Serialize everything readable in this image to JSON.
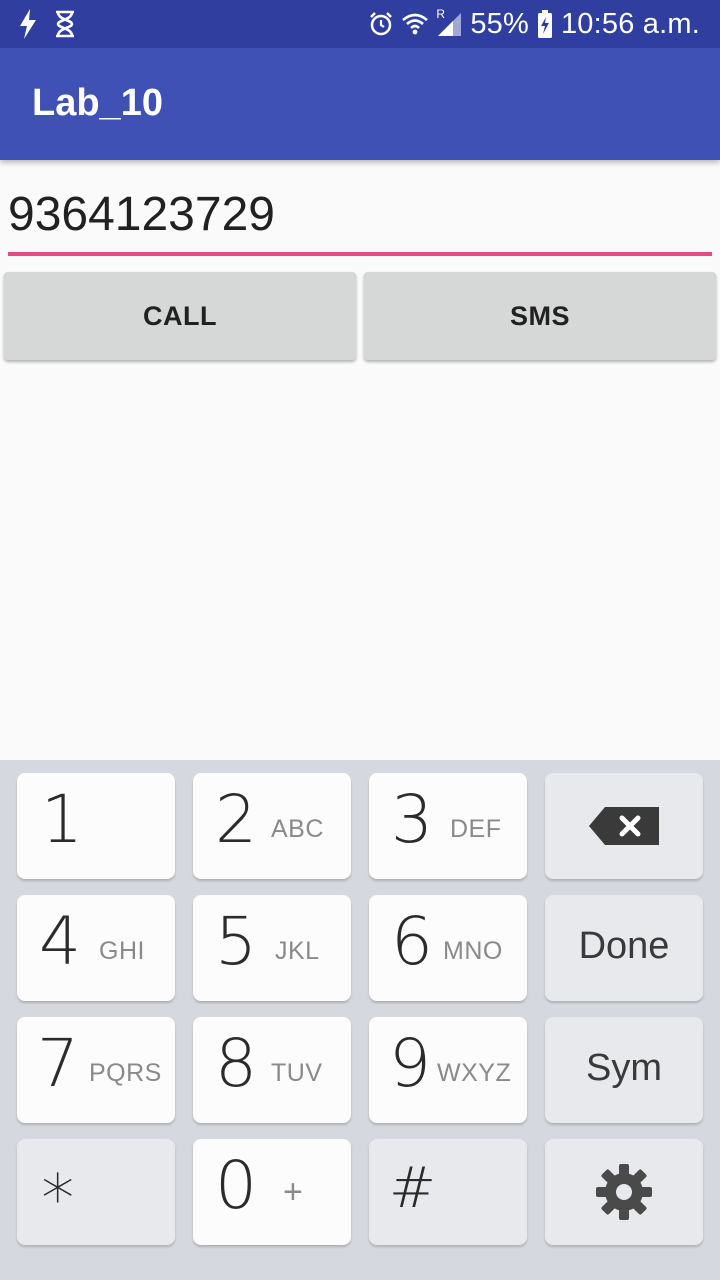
{
  "status_bar": {
    "battery": "55%",
    "time": "10:56 a.m.",
    "roaming": "R",
    "icons": [
      "flash-icon",
      "hourglass-icon",
      "alarm-icon",
      "wifi-icon",
      "signal-icon",
      "battery-charging-icon"
    ]
  },
  "app_bar": {
    "title": "Lab_10"
  },
  "form": {
    "phone_value": "9364123729",
    "call_label": "CALL",
    "sms_label": "SMS"
  },
  "colors": {
    "status_bar": "#303f9f",
    "app_bar": "#3f51b5",
    "accent": "#e64a85",
    "button": "#d6d7d7",
    "keyboard_bg": "#d5d8de"
  },
  "keyboard": {
    "k1": {
      "digit": "1",
      "letters": ""
    },
    "k2": {
      "digit": "2",
      "letters": "ABC"
    },
    "k3": {
      "digit": "3",
      "letters": "DEF"
    },
    "k4": {
      "digit": "4",
      "letters": "GHI"
    },
    "k5": {
      "digit": "5",
      "letters": "JKL"
    },
    "k6": {
      "digit": "6",
      "letters": "MNO"
    },
    "k7": {
      "digit": "7",
      "letters": "PQRS"
    },
    "k8": {
      "digit": "8",
      "letters": "TUV"
    },
    "k9": {
      "digit": "9",
      "letters": "WXYZ"
    },
    "k0": {
      "digit": "0",
      "letters": "+"
    },
    "star": "∗",
    "hash": "#",
    "done": "Done",
    "sym": "Sym",
    "backspace_icon": "backspace-icon",
    "settings_icon": "gear-icon"
  }
}
